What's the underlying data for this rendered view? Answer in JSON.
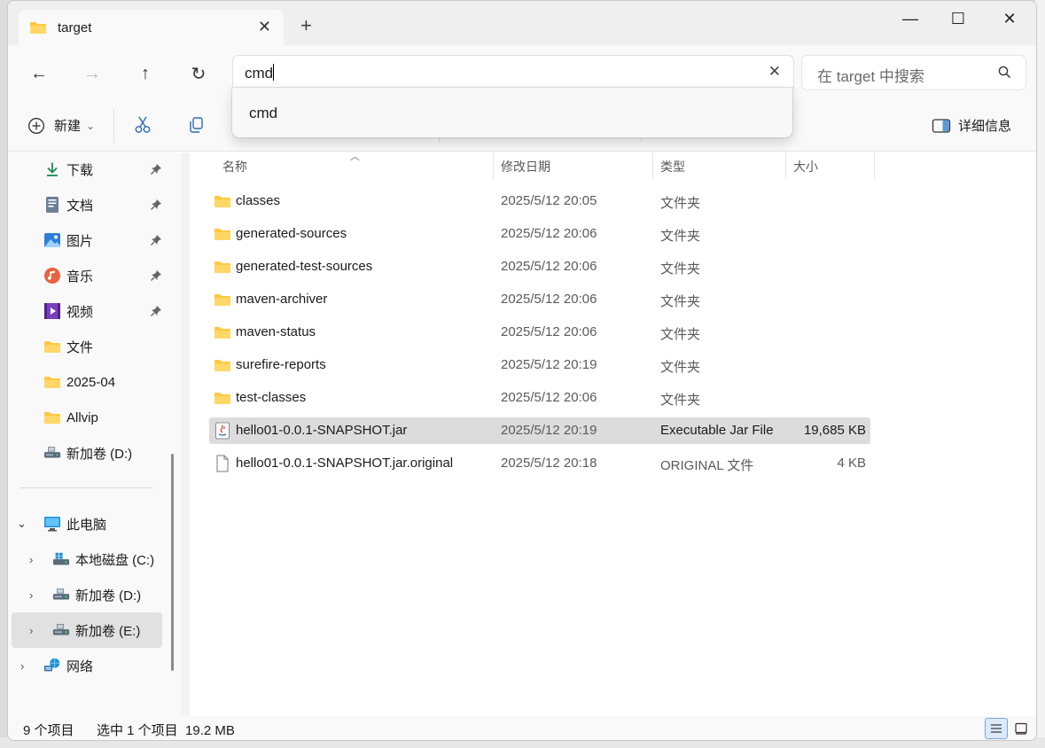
{
  "colors": {
    "accent": "#005fb8",
    "folder": "#ffc83d",
    "selection": "#dcdcdc"
  },
  "window": {
    "tab_title": "target",
    "tab_close": "✕",
    "new_tab": "+",
    "minimize": "—",
    "maximize": "☐",
    "close": "✕"
  },
  "nav": {
    "back": "←",
    "forward": "→",
    "up": "↑",
    "refresh": "↻",
    "address_value": "cmd",
    "address_clear": "✕",
    "search_placeholder": "在 target 中搜索"
  },
  "suggestions": [
    "cmd"
  ],
  "toolbar": {
    "new_label": "新建",
    "new_dropdown": "⌄",
    "details_label": "详细信息"
  },
  "sidebar": {
    "quick_access": [
      {
        "label": "下载",
        "icon": "download-icon",
        "pinned": true
      },
      {
        "label": "文档",
        "icon": "document-icon",
        "pinned": true
      },
      {
        "label": "图片",
        "icon": "pictures-icon",
        "pinned": true
      },
      {
        "label": "音乐",
        "icon": "music-icon",
        "pinned": true
      },
      {
        "label": "视频",
        "icon": "video-icon",
        "pinned": true
      },
      {
        "label": "文件",
        "icon": "folder-icon",
        "pinned": false
      },
      {
        "label": "2025-04",
        "icon": "folder-icon",
        "pinned": false
      },
      {
        "label": "Allvip",
        "icon": "folder-icon",
        "pinned": false
      },
      {
        "label": "新加卷 (D:)",
        "icon": "drive-icon",
        "pinned": false
      }
    ],
    "this_pc": "此电脑",
    "drives": [
      {
        "label": "本地磁盘 (C:)",
        "icon": "system-drive-icon"
      },
      {
        "label": "新加卷 (D:)",
        "icon": "drive-icon"
      },
      {
        "label": "新加卷 (E:)",
        "icon": "drive-icon",
        "selected": true
      }
    ],
    "network": "网络"
  },
  "columns": {
    "name": "名称",
    "date": "修改日期",
    "type": "类型",
    "size": "大小"
  },
  "files": [
    {
      "name": "classes",
      "date": "2025/5/12 20:05",
      "type": "文件夹",
      "size": "",
      "icon": "folder-icon"
    },
    {
      "name": "generated-sources",
      "date": "2025/5/12 20:06",
      "type": "文件夹",
      "size": "",
      "icon": "folder-icon"
    },
    {
      "name": "generated-test-sources",
      "date": "2025/5/12 20:06",
      "type": "文件夹",
      "size": "",
      "icon": "folder-icon"
    },
    {
      "name": "maven-archiver",
      "date": "2025/5/12 20:06",
      "type": "文件夹",
      "size": "",
      "icon": "folder-icon"
    },
    {
      "name": "maven-status",
      "date": "2025/5/12 20:06",
      "type": "文件夹",
      "size": "",
      "icon": "folder-icon"
    },
    {
      "name": "surefire-reports",
      "date": "2025/5/12 20:19",
      "type": "文件夹",
      "size": "",
      "icon": "folder-icon"
    },
    {
      "name": "test-classes",
      "date": "2025/5/12 20:06",
      "type": "文件夹",
      "size": "",
      "icon": "folder-icon"
    },
    {
      "name": "hello01-0.0.1-SNAPSHOT.jar",
      "date": "2025/5/12 20:19",
      "type": "Executable Jar File",
      "size": "19,685 KB",
      "icon": "java-jar-icon",
      "selected": true
    },
    {
      "name": "hello01-0.0.1-SNAPSHOT.jar.original",
      "date": "2025/5/12 20:18",
      "type": "ORIGINAL 文件",
      "size": "4 KB",
      "icon": "blank-file-icon"
    }
  ],
  "status": {
    "item_count": "9 个项目",
    "selection": "选中 1 个项目  19.2 MB"
  }
}
